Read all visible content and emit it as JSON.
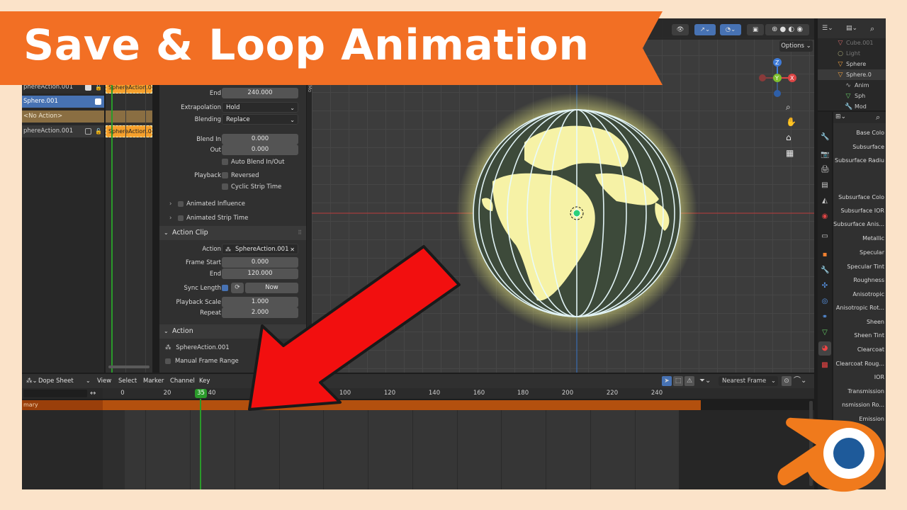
{
  "banner": {
    "title": "Save & Loop Animation"
  },
  "nla": {
    "tracks": [
      {
        "label": "phereAction.001",
        "checked": true
      },
      {
        "label": "Sphere.001",
        "checked": true
      },
      {
        "label": "<No Action>"
      },
      {
        "label": "phereAction.001",
        "checked": false
      }
    ],
    "strips": [
      "SphereAction.0",
      "SphereAction.0"
    ]
  },
  "strip_props": {
    "end_label": "End",
    "end_value": "240.000",
    "extrapolation_label": "Extrapolation",
    "extrapolation_value": "Hold",
    "blending_label": "Blending",
    "blending_value": "Replace",
    "blend_in_label": "Blend In",
    "blend_in_value": "0.000",
    "out_label": "Out",
    "out_value": "0.000",
    "auto_blend_label": "Auto Blend In/Out",
    "playback_label": "Playback",
    "reversed_label": "Reversed",
    "cyclic_label": "Cyclic Strip Time",
    "animated_influence_label": "Animated Influence",
    "animated_strip_time_label": "Animated Strip Time"
  },
  "action_clip": {
    "header": "Action Clip",
    "action_label": "Action",
    "action_value": "SphereAction.001",
    "frame_start_label": "Frame Start",
    "frame_start_value": "0.000",
    "end_label": "End",
    "end_value": "120.000",
    "sync_length_label": "Sync Length",
    "now_label": "Now",
    "playback_scale_label": "Playback Scale",
    "playback_scale_value": "1.000",
    "repeat_label": "Repeat",
    "repeat_value": "2.000"
  },
  "action_section": {
    "header": "Action",
    "action_name": "SphereAction.001",
    "manual_frame_range_label": "Manual Frame Range"
  },
  "viewport": {
    "options_label": "Options",
    "side_tab": "Mo"
  },
  "outliner": {
    "items": [
      "Cube.001",
      "Light",
      "Sphere",
      "Sphere.0",
      "Anim",
      "Sph",
      "Mod"
    ]
  },
  "material": {
    "labels": [
      "Base Colo",
      "Subsurface",
      "Subsurface Radiu",
      "Subsurface Colo",
      "Subsurface IOR",
      "Subsurface Anis...",
      "Metallic",
      "Specular",
      "Specular Tint",
      "Roughness",
      "Anisotropic",
      "Anisotropic Rot...",
      "Sheen",
      "Sheen Tint",
      "Clearcoat",
      "Clearcoat Roug...",
      "IOR",
      "Transmission",
      "nsmission Ro...",
      "Emission"
    ]
  },
  "dopesheet": {
    "mode": "Dope Sheet",
    "menus": [
      "View",
      "Select",
      "Marker",
      "Channel",
      "Key"
    ],
    "snap": "Nearest Frame",
    "current_frame": "35",
    "ticks": [
      "0",
      "20",
      "40",
      "80",
      "100",
      "120",
      "140",
      "160",
      "180",
      "200",
      "220",
      "240"
    ],
    "summary_label": "mary"
  },
  "colors": {
    "banner": "#f26f24",
    "accent_blue": "#4772b3",
    "strip_orange": "#f6a02c",
    "playhead_green": "#2a9a2a",
    "arrow_red": "#f20f0f",
    "blender_logo_orange": "#f07a1c",
    "blender_logo_blue": "#1e5a9a"
  }
}
